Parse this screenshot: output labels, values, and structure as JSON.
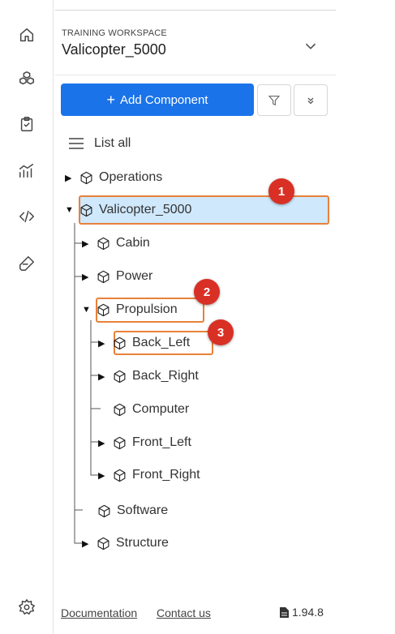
{
  "workspace": {
    "label": "TRAINING WORKSPACE",
    "name": "Valicopter_5000"
  },
  "toolbar": {
    "add_label": "Add Component",
    "filter_icon": "filter-icon",
    "collapse_icon": "double-chevron-down-icon"
  },
  "list_all": "List all",
  "rail": [
    "home-icon",
    "components-icon",
    "requirements-icon",
    "analytics-icon",
    "code-icon",
    "test-icon",
    "settings-icon"
  ],
  "tree": {
    "operations": "Operations",
    "root": "Valicopter_5000",
    "cabin": "Cabin",
    "power": "Power",
    "propulsion": "Propulsion",
    "back_left": "Back_Left",
    "back_right": "Back_Right",
    "computer": "Computer",
    "front_left": "Front_Left",
    "front_right": "Front_Right",
    "software": "Software",
    "structure": "Structure"
  },
  "badges": {
    "b1": "1",
    "b2": "2",
    "b3": "3"
  },
  "footer": {
    "documentation": "Documentation",
    "contact": "Contact us",
    "version": "1.94.8"
  },
  "colors": {
    "accent": "#1a73e8",
    "highlight": "#e8813a",
    "selected": "#cfe8fc",
    "badge": "#d93025"
  }
}
